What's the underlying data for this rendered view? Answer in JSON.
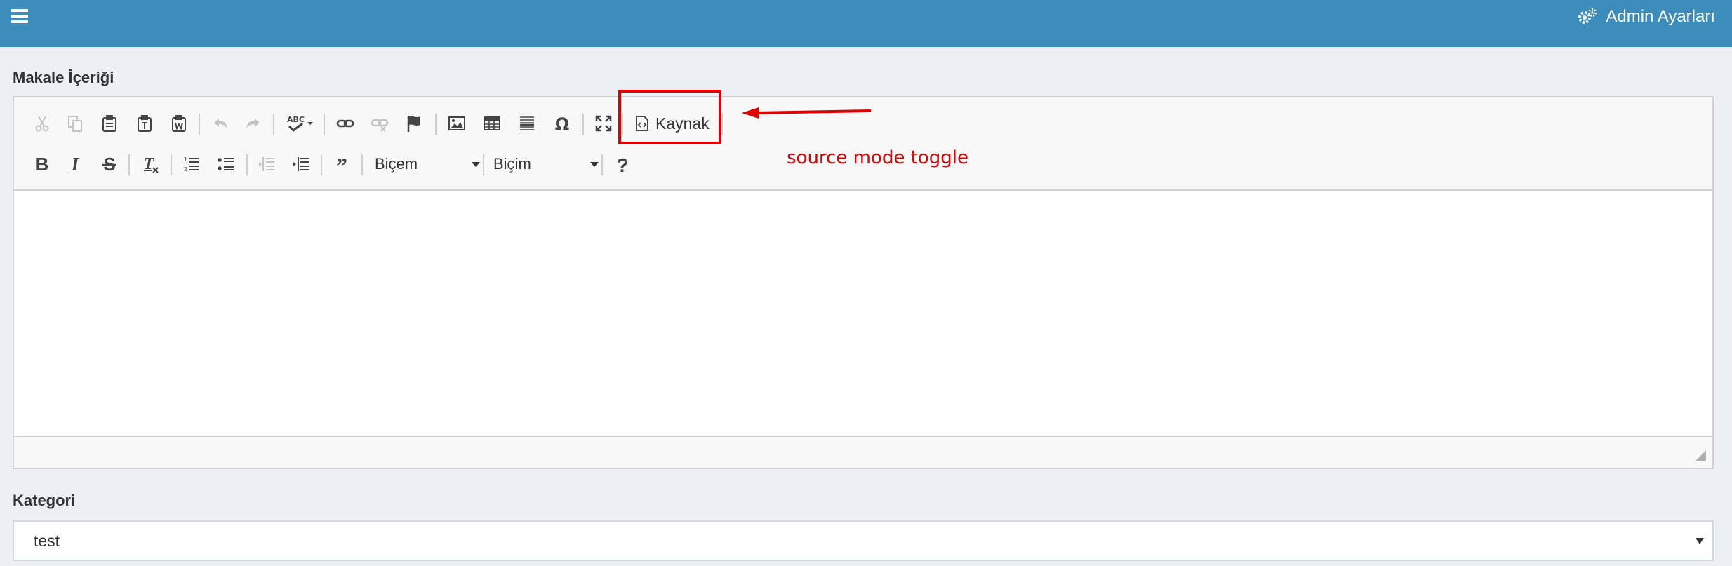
{
  "header": {
    "admin_label": "Admin Ayarları"
  },
  "form": {
    "content_label": "Makale İçeriği",
    "category_label": "Kategori",
    "category_value": "test"
  },
  "toolbar": {
    "source_label": "Kaynak",
    "style_combo": "Biçem",
    "format_combo": "Biçim"
  },
  "annotation": {
    "text": "source mode toggle",
    "color": "#e00000"
  },
  "colors": {
    "header_bg": "#3c8dbc",
    "page_bg": "#ecf0f5"
  }
}
